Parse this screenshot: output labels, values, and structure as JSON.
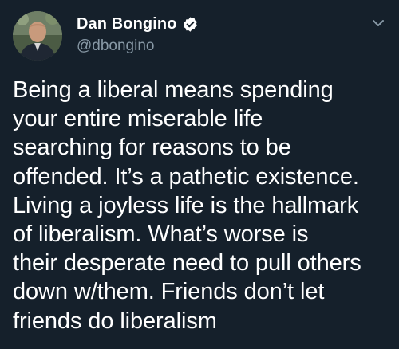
{
  "author": {
    "display_name": "Dan Bongino",
    "handle": "@dbongino",
    "verified": true
  },
  "tweet": {
    "lines": [
      "Being a liberal means spending",
      "your entire miserable life",
      "searching for reasons to be",
      "offended. It’s a pathetic existence.",
      "Living a joyless life is the hallmark",
      "of liberalism. What’s worse is",
      "their desperate need to pull others",
      "down w/them. Friends don’t let",
      "friends do liberalism"
    ]
  },
  "colors": {
    "background": "#15202b",
    "text_primary": "#ffffff",
    "text_secondary": "#8899a6"
  },
  "icons": {
    "verified": "verified-badge-icon",
    "caret": "chevron-down-icon"
  }
}
